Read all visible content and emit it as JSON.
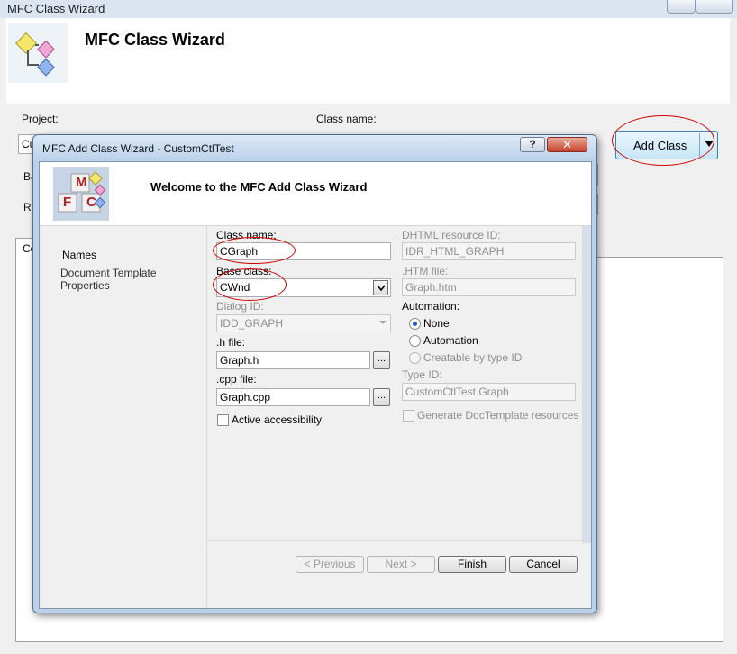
{
  "outer_window": {
    "title": "MFC Class Wizard",
    "heading": "MFC Class Wizard",
    "project_label": "Project:",
    "project_value": "Cu",
    "class_name_label": "Class name:",
    "base_class_label_fragment": "Ba",
    "resource_label_fragment": "Re",
    "tab_fragment": "Co",
    "add_class_label": "Add Class"
  },
  "dialog": {
    "title": "MFC Add Class Wizard - CustomCtlTest",
    "help_label": "?",
    "close_label": "✕",
    "heading": "Welcome to the MFC Add Class Wizard",
    "logo_letters": [
      "M",
      "F",
      "C"
    ],
    "nav": {
      "items": [
        {
          "label": "Names"
        },
        {
          "label": "Document Template Properties"
        }
      ]
    },
    "form": {
      "class_name_label": "Class name:",
      "class_name_value": "CGraph",
      "base_class_label": "Base class:",
      "base_class_value": "CWnd",
      "dialog_id_label": "Dialog ID:",
      "dialog_id_value": "IDD_GRAPH",
      "h_file_label": ".h file:",
      "h_file_value": "Graph.h",
      "cpp_file_label": ".cpp file:",
      "cpp_file_value": "Graph.cpp",
      "browse_label": "...",
      "active_accessibility_label": "Active accessibility",
      "dhtml_resource_id_label": "DHTML resource ID:",
      "dhtml_resource_id_value": "IDR_HTML_GRAPH",
      "htm_file_label": ".HTM file:",
      "htm_file_value": "Graph.htm",
      "automation_label": "Automation:",
      "automation_options": [
        {
          "label": "None",
          "selected": true,
          "enabled": true
        },
        {
          "label": "Automation",
          "selected": false,
          "enabled": true
        },
        {
          "label": "Creatable by type ID",
          "selected": false,
          "enabled": false
        }
      ],
      "type_id_label": "Type ID:",
      "type_id_value": "CustomCtlTest.Graph",
      "generate_doctemplate_label": "Generate DocTemplate resources"
    },
    "buttons": {
      "previous": "< Previous",
      "next": "Next >",
      "finish": "Finish",
      "cancel": "Cancel"
    }
  }
}
